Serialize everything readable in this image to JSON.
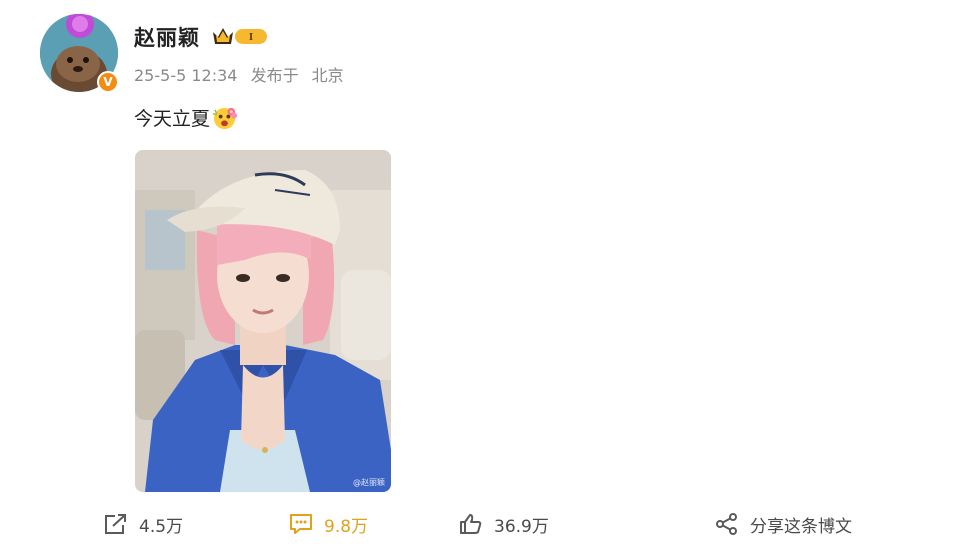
{
  "post": {
    "author": "赵丽颖",
    "vip_level": "I",
    "date": "25-5-5 12:34",
    "location_prefix": "发布于",
    "location": "北京",
    "text": "今天立夏",
    "photo_watermark": "@赵丽颖"
  },
  "actions": {
    "repost_count": "4.5万",
    "comment_count": "9.8万",
    "like_count": "36.9万",
    "share_label": "分享这条博文"
  },
  "icons": {
    "verified": "verified-v-icon",
    "vip": "crown-vip-icon",
    "repost": "repost-icon",
    "comment": "comment-icon",
    "like": "thumbs-up-icon",
    "share": "share-icon",
    "emoji": "flower-face-emoji"
  },
  "colors": {
    "comment_active": "#e0a21a",
    "verified_badge": "#f28c12",
    "vip_badge": "#f5b82e",
    "meta_text": "#8a8a8a"
  }
}
